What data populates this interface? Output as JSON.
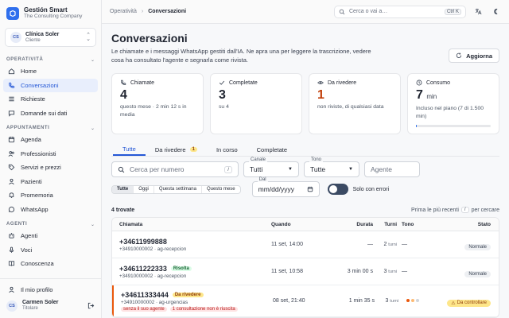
{
  "brand": {
    "name": "Gestión Smart",
    "subtitle": "The Consulting Company"
  },
  "client": {
    "initials": "CS",
    "name": "Clínica Soler",
    "role": "Cliente"
  },
  "sidebar": {
    "sections": [
      {
        "title": "OPERATIVITÀ",
        "items": [
          {
            "label": "Home",
            "icon": "home-icon"
          },
          {
            "label": "Conversazioni",
            "icon": "phone-icon",
            "active": true
          },
          {
            "label": "Richieste",
            "icon": "list-icon"
          },
          {
            "label": "Domande sui dati",
            "icon": "chat-icon"
          }
        ]
      },
      {
        "title": "APPUNTAMENTI",
        "items": [
          {
            "label": "Agenda",
            "icon": "calendar-icon"
          },
          {
            "label": "Professionisti",
            "icon": "people-icon"
          },
          {
            "label": "Servizi e prezzi",
            "icon": "tag-icon"
          },
          {
            "label": "Pazienti",
            "icon": "patients-icon"
          },
          {
            "label": "Promemoria",
            "icon": "bell-icon"
          },
          {
            "label": "WhatsApp",
            "icon": "whatsapp-icon"
          }
        ]
      },
      {
        "title": "AGENTI",
        "items": [
          {
            "label": "Agenti",
            "icon": "robot-icon"
          },
          {
            "label": "Voci",
            "icon": "mic-icon"
          },
          {
            "label": "Conoscenza",
            "icon": "book-icon"
          }
        ]
      }
    ],
    "profile_link": "Il mio profilo",
    "user": {
      "initials": "CS",
      "name": "Carmen Soler",
      "role": "Titolare"
    }
  },
  "topbar": {
    "crumb1": "Operatività",
    "crumb2": "Conversazioni",
    "search_placeholder": "Cerca o vai a…",
    "search_kbd": "Ctrl K"
  },
  "page": {
    "title": "Conversazioni",
    "description": "Le chiamate e i messaggi WhatsApp gestiti dall'IA. Ne apra una per leggere la trascrizione, vedere cosa ha consultato l'agente e segnarla come rivista.",
    "refresh": "Aggiorna"
  },
  "cards": [
    {
      "label": "Chiamate",
      "value": "4",
      "sub": "questo mese · 2 min 12 s in media"
    },
    {
      "label": "Completate",
      "value": "3",
      "sub": "su 4"
    },
    {
      "label": "Da rivedere",
      "value": "1",
      "sub": "non riviste, di qualsiasi data"
    },
    {
      "label": "Consumo",
      "value": "7",
      "unit": "min",
      "sub": "Incluso nel piano (7 di 1.500 min)",
      "progress": 0.005
    }
  ],
  "tabs": [
    {
      "label": "Tutte"
    },
    {
      "label": "Da rivedere",
      "badge": "1"
    },
    {
      "label": "In corso"
    },
    {
      "label": "Completate"
    }
  ],
  "filters": {
    "search_placeholder": "Cerca per numero",
    "search_kbd": "/",
    "canale_label": "Canale",
    "canale_value": "Tutti",
    "tono_label": "Tono",
    "tono_value": "Tutte",
    "agente_placeholder": "Agente",
    "periods": [
      "Tutte",
      "Oggi",
      "Questa settimana",
      "Questo mese"
    ],
    "dal_label": "Dal",
    "dal_value": "mm/dd/yyyy",
    "only_errors": "Solo con errori"
  },
  "list": {
    "found": "4 trovate",
    "sort_label": "Prima le più recenti",
    "sort_kbd": "/",
    "sort_suffix": "per cercare"
  },
  "table": {
    "headers": [
      "Chiamata",
      "Quando",
      "Durata",
      "Turni",
      "Tono",
      "Stato"
    ],
    "rows": [
      {
        "number": "+34611999888",
        "sub": "+34910000002 · ag-recepcion",
        "when": "11 set, 14:00",
        "duration": "—",
        "turns": "2",
        "turns_unit": "turni",
        "tone": "—",
        "status": "Normale"
      },
      {
        "number": "+34611222333",
        "tag": "Risolta",
        "sub": "+34910000002 · ag-recepcion",
        "when": "11 set, 10:58",
        "duration": "3 min 00 s",
        "turns": "3",
        "turns_unit": "turni",
        "tone": "—",
        "status": "Normale"
      },
      {
        "number": "+34611333444",
        "tag": "Da rivedere",
        "sub": "+34910000002 · ag-urgencias",
        "tags2": [
          "senza il suo agente",
          "1 consultazione non è riuscita"
        ],
        "when": "08 set, 21:40",
        "duration": "1 min 35 s",
        "turns": "3",
        "turns_unit": "turni",
        "status": "Da controllare"
      }
    ]
  }
}
